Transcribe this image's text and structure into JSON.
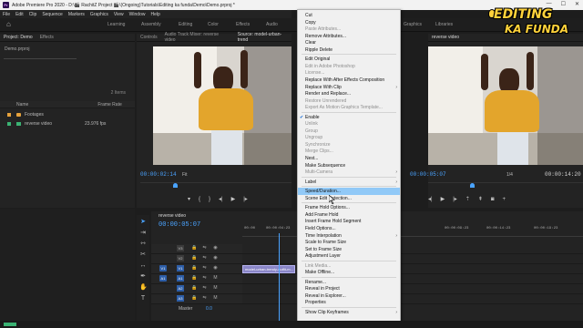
{
  "window": {
    "app_logo": "Pr",
    "title": "Adobe Premiere Pro 2020 - D:\\🎬 RachitZ Project 🎬\\(Ongoing)Tutorials\\Editing ka funda\\Demo\\Demo.prproj *",
    "minimize": "—",
    "maximize": "☐",
    "close": "✕"
  },
  "menu": [
    "File",
    "Edit",
    "Clip",
    "Sequence",
    "Markers",
    "Graphics",
    "View",
    "Window",
    "Help"
  ],
  "workspaces": [
    "Learning",
    "Assembly",
    "Editing",
    "Color",
    "Effects",
    "Audio",
    "Graphics",
    "Libraries"
  ],
  "logo": {
    "line1": "EDITING",
    "line2": "KA FUNDA"
  },
  "project": {
    "tabs": [
      "Project: Demo",
      "Effects"
    ],
    "file": "Demo.prproj",
    "item_count": "2 Items",
    "columns": {
      "name": "Name",
      "frame_rate": "Frame Rate"
    },
    "items": [
      {
        "name": "Footages",
        "type": "folder",
        "frame_rate": "",
        "color": "#e6a23c"
      },
      {
        "name": "reverse video",
        "type": "sequence",
        "frame_rate": "23.976 fps",
        "color": "#3bb273"
      }
    ]
  },
  "source": {
    "tabs": [
      "Controls",
      "Audio Track Mixer: reverse video",
      "Source: model-urban-trend"
    ],
    "timecode": "00:00:02:14",
    "fit": "Fit"
  },
  "program": {
    "tab": "reverse video",
    "timecode": "00:00:05:07",
    "fraction": "1/4",
    "duration": "00:00:14:20"
  },
  "timeline": {
    "tab": "reverse video",
    "timecode": "00:00:05:07",
    "ruler": [
      "00:00",
      "00:00:04:23",
      "00:00:09:23",
      "00:00:14:23",
      "00:00:19:23"
    ],
    "tracks": [
      {
        "src": "",
        "name": "V3"
      },
      {
        "src": "",
        "name": "V2"
      },
      {
        "src": "V1",
        "name": "V1",
        "clip": "model-urban-trendy-outfit-m..."
      },
      {
        "src": "A1",
        "name": "A1"
      },
      {
        "src": "A2",
        "name": "A2"
      },
      {
        "src": "A3",
        "name": "A3"
      }
    ],
    "master": {
      "label": "Master",
      "value": "0.0"
    }
  },
  "context_menu": [
    {
      "label": "Cut",
      "state": "enabled"
    },
    {
      "label": "Copy",
      "state": "enabled"
    },
    {
      "label": "Paste Attributes...",
      "state": "disabled"
    },
    {
      "label": "Remove Attributes...",
      "state": "enabled"
    },
    {
      "label": "Clear",
      "state": "enabled"
    },
    {
      "label": "Ripple Delete",
      "state": "enabled"
    },
    {
      "sep": true
    },
    {
      "label": "Edit Original",
      "state": "enabled"
    },
    {
      "label": "Edit in Adobe Photoshop",
      "state": "disabled"
    },
    {
      "label": "License...",
      "state": "disabled"
    },
    {
      "label": "Replace With After Effects Composition",
      "state": "enabled"
    },
    {
      "label": "Replace With Clip",
      "state": "enabled",
      "submenu": true
    },
    {
      "label": "Render and Replace...",
      "state": "enabled"
    },
    {
      "label": "Restore Unrendered",
      "state": "disabled"
    },
    {
      "label": "Export As Motion Graphics Template...",
      "state": "disabled"
    },
    {
      "sep": true
    },
    {
      "label": "Enable",
      "state": "enabled",
      "checked": true
    },
    {
      "label": "Unlink",
      "state": "disabled"
    },
    {
      "label": "Group",
      "state": "disabled"
    },
    {
      "label": "Ungroup",
      "state": "disabled"
    },
    {
      "label": "Synchronize",
      "state": "disabled"
    },
    {
      "label": "Merge Clips...",
      "state": "disabled"
    },
    {
      "label": "Nest...",
      "state": "enabled"
    },
    {
      "label": "Make Subsequence",
      "state": "enabled"
    },
    {
      "label": "Multi-Camera",
      "state": "disabled",
      "submenu": true
    },
    {
      "sep": true
    },
    {
      "label": "Label",
      "state": "enabled",
      "submenu": true
    },
    {
      "sep": true
    },
    {
      "label": "Speed/Duration...",
      "state": "enabled",
      "hover": true
    },
    {
      "label": "Scene Edit Detection...",
      "state": "enabled"
    },
    {
      "sep": true
    },
    {
      "label": "Frame Hold Options...",
      "state": "enabled"
    },
    {
      "label": "Add Frame Hold",
      "state": "enabled"
    },
    {
      "label": "Insert Frame Hold Segment",
      "state": "enabled"
    },
    {
      "label": "Field Options...",
      "state": "enabled"
    },
    {
      "label": "Time Interpolation",
      "state": "enabled",
      "submenu": true
    },
    {
      "label": "Scale to Frame Size",
      "state": "enabled"
    },
    {
      "label": "Set to Frame Size",
      "state": "enabled"
    },
    {
      "label": "Adjustment Layer",
      "state": "enabled"
    },
    {
      "sep": true
    },
    {
      "label": "Link Media...",
      "state": "disabled"
    },
    {
      "label": "Make Offline...",
      "state": "enabled"
    },
    {
      "sep": true
    },
    {
      "label": "Rename...",
      "state": "enabled"
    },
    {
      "label": "Reveal in Project",
      "state": "enabled"
    },
    {
      "label": "Reveal in Explorer...",
      "state": "enabled"
    },
    {
      "label": "Properties",
      "state": "enabled"
    },
    {
      "sep": true
    },
    {
      "label": "Show Clip Keyframes",
      "state": "enabled",
      "submenu": true
    }
  ]
}
